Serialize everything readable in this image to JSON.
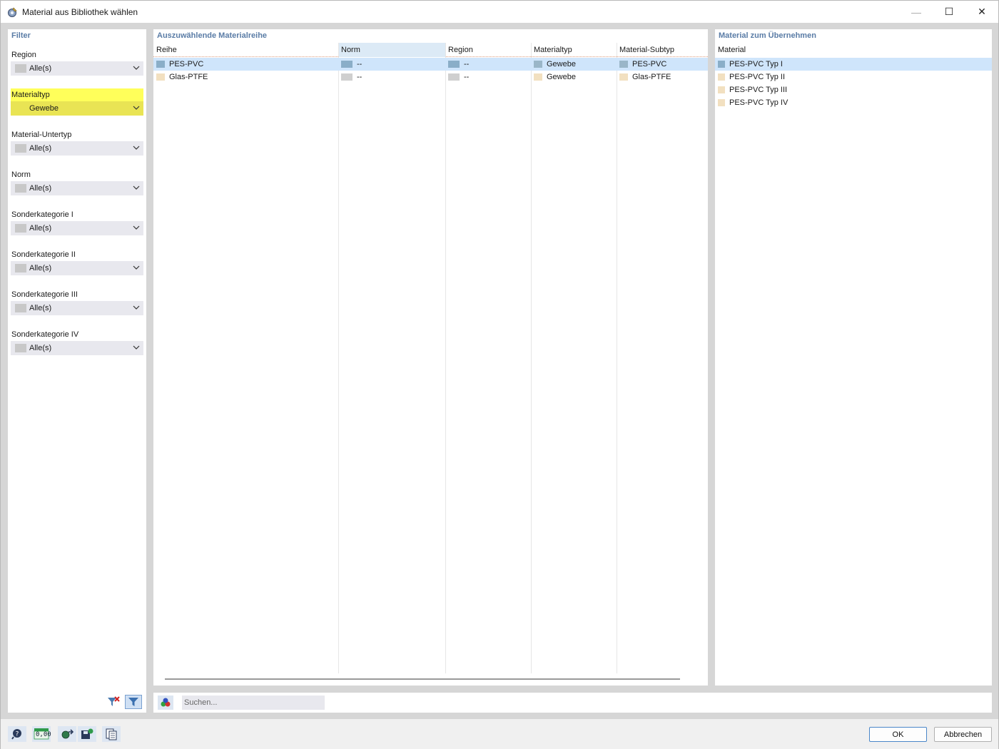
{
  "window": {
    "title": "Material aus Bibliothek wählen",
    "controls": {
      "minimize": "—",
      "maximize": "☐",
      "close": "✕"
    }
  },
  "filter": {
    "title": "Filter",
    "groups": [
      {
        "label": "Region",
        "value": "Alle(s)"
      },
      {
        "label": "Materialtyp",
        "value": "Gewebe"
      },
      {
        "label": "Material-Untertyp",
        "value": "Alle(s)"
      },
      {
        "label": "Norm",
        "value": "Alle(s)"
      },
      {
        "label": "Sonderkategorie I",
        "value": "Alle(s)"
      },
      {
        "label": "Sonderkategorie II",
        "value": "Alle(s)"
      },
      {
        "label": "Sonderkategorie III",
        "value": "Alle(s)"
      },
      {
        "label": "Sonderkategorie IV",
        "value": "Alle(s)"
      }
    ],
    "highlight_color": "#ffff5a"
  },
  "series_panel": {
    "title": "Auszuwählende Materialreihe",
    "columns": [
      "Reihe",
      "Norm",
      "Region",
      "Materialtyp",
      "Material-Subtyp"
    ],
    "rows": [
      {
        "reihe": "PES-PVC",
        "norm": "--",
        "region": "--",
        "materialtyp": "Gewebe",
        "subtyp": "PES-PVC"
      },
      {
        "reihe": "Glas-PTFE",
        "norm": "--",
        "region": "--",
        "materialtyp": "Gewebe",
        "subtyp": "Glas-PTFE"
      }
    ]
  },
  "material_panel": {
    "title": "Material zum Übernehmen",
    "column": "Material",
    "items": [
      "PES-PVC Typ I",
      "PES-PVC Typ II",
      "PES-PVC Typ III",
      "PES-PVC Typ IV"
    ]
  },
  "search": {
    "placeholder": "Suchen..."
  },
  "buttons": {
    "ok": "OK",
    "cancel": "Abbrechen",
    "units_label": "0,00"
  },
  "colors": {
    "accent_title": "#5a7ca6",
    "selection": "#cfe5fb"
  }
}
